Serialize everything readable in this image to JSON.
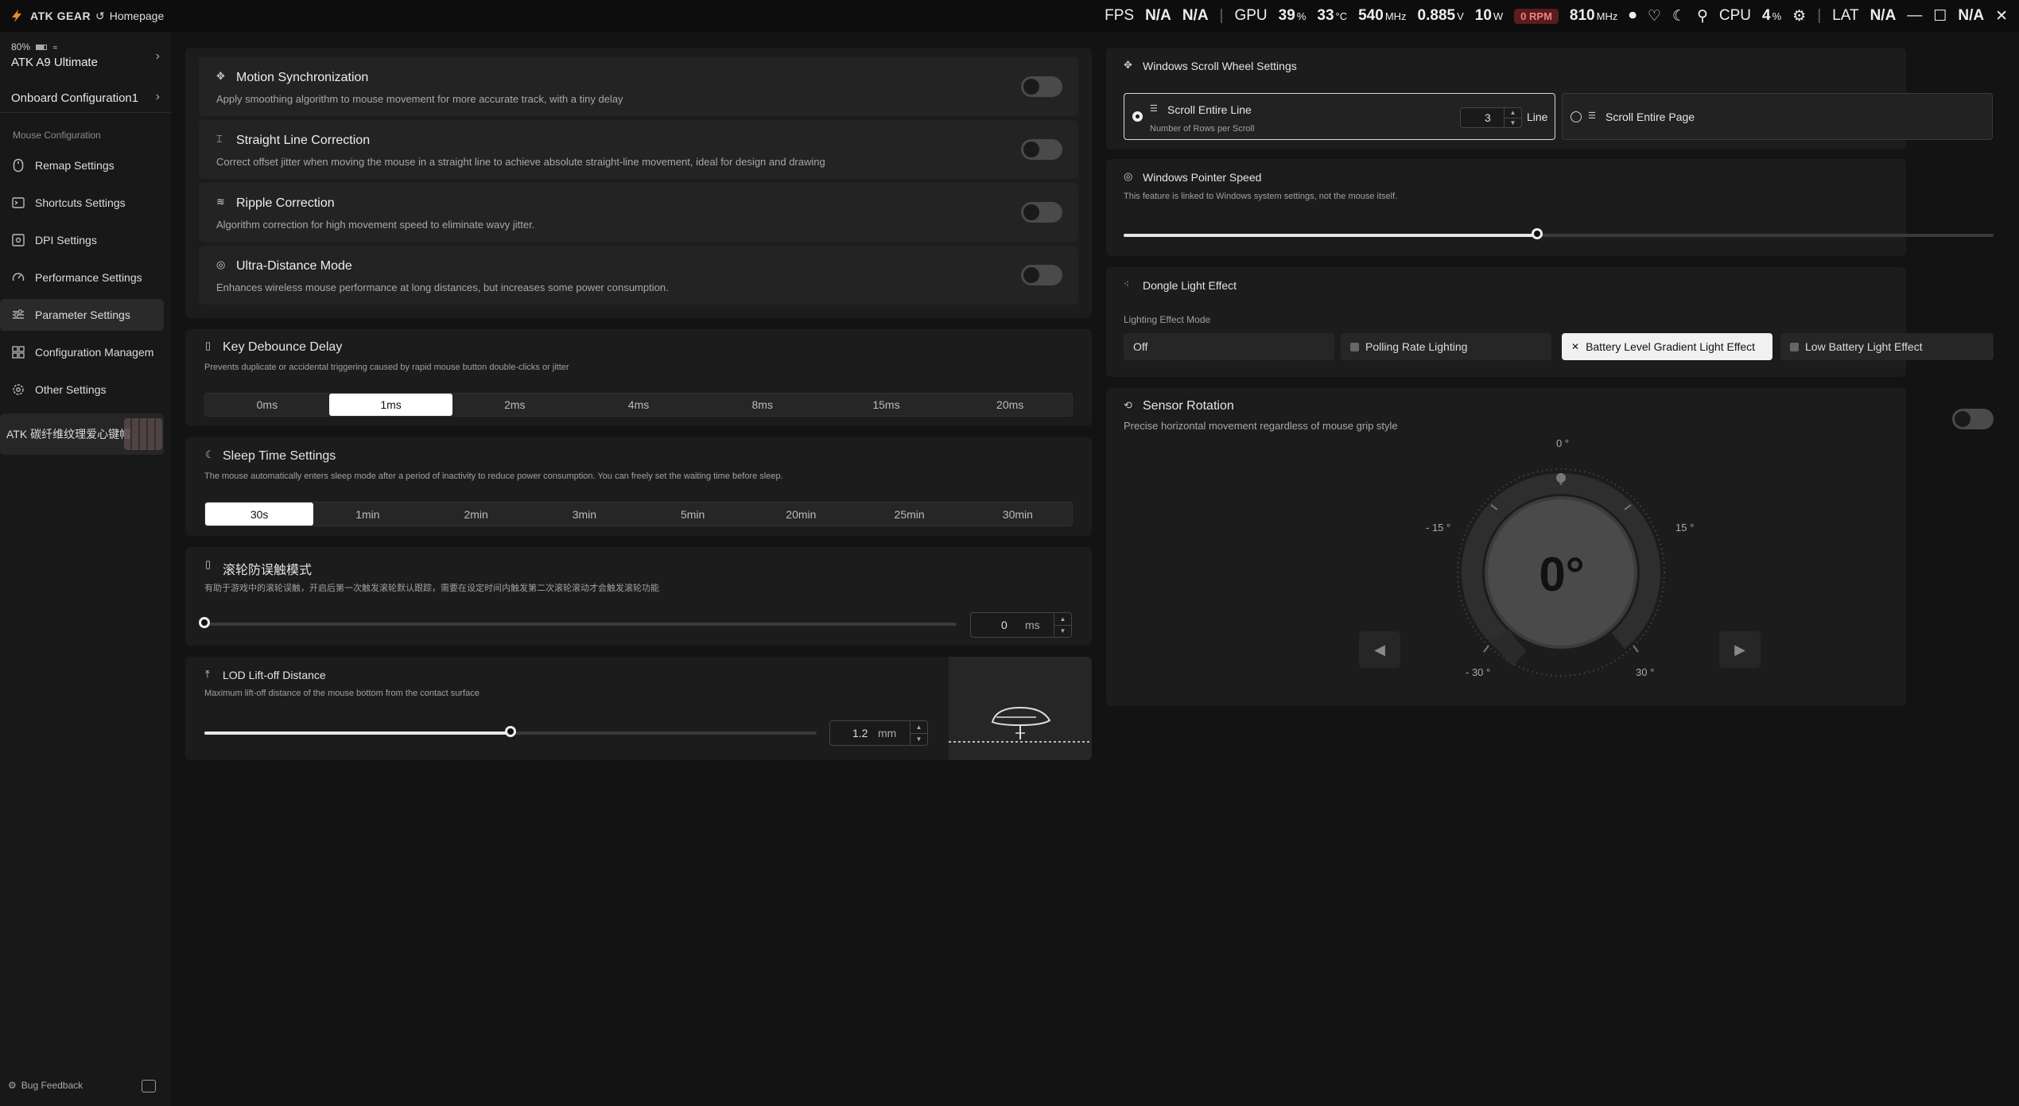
{
  "app": {
    "brand": "ATK GEAR",
    "home_label": "Homepage"
  },
  "stats": {
    "fps_label": "FPS",
    "fps": "N/A",
    "fps2": "N/A",
    "gpu_label": "GPU",
    "gpu_load": "39",
    "gpu_load_unit": "%",
    "gpu_temp": "33",
    "gpu_temp_unit": "°C",
    "gpu_clock": "540",
    "gpu_clock_unit": "MHz",
    "gpu_volt": "0.885",
    "gpu_volt_unit": "V",
    "gpu_power": "10",
    "gpu_power_unit": "W",
    "fan": "0",
    "fan_unit": "RPM",
    "mem_clock": "810",
    "mem_clock_unit": "MHz",
    "cpu_label": "CPU",
    "cpu_load": "4",
    "cpu_load_unit": "%",
    "lat_label": "LAT",
    "lat": "N/A",
    "lat2": "N/A"
  },
  "sidebar": {
    "device_battery": "80%",
    "device_name": "ATK A9 Ultimate",
    "onboard": "Onboard Configuration1",
    "section_label": "Mouse Configuration",
    "items": [
      {
        "label": "Remap Settings",
        "icon": "mouse-icon"
      },
      {
        "label": "Shortcuts Settings",
        "icon": "terminal-icon"
      },
      {
        "label": "DPI Settings",
        "icon": "dpi-icon"
      },
      {
        "label": "Performance Settings",
        "icon": "gauge-icon"
      },
      {
        "label": "Parameter Settings",
        "icon": "sliders-icon"
      },
      {
        "label": "Configuration Managem",
        "icon": "grid-icon"
      },
      {
        "label": "Other Settings",
        "icon": "gear-icon"
      }
    ],
    "active_index": 4,
    "promo": "ATK 碳纤维纹理爱心键帽",
    "bug_feedback": "Bug Feedback"
  },
  "features": [
    {
      "title": "Motion Synchronization",
      "desc": "Apply smoothing algorithm to mouse movement for more accurate track, with a tiny delay",
      "enabled": false
    },
    {
      "title": "Straight Line Correction",
      "desc": "Correct offset jitter when moving the mouse in a straight line to achieve absolute straight-line movement, ideal for design and drawing",
      "enabled": false
    },
    {
      "title": "Ripple Correction",
      "desc": "Algorithm correction for high movement speed to eliminate wavy jitter.",
      "enabled": false
    },
    {
      "title": "Ultra-Distance Mode",
      "desc": "Enhances wireless mouse performance at long distances, but increases some power consumption.",
      "enabled": false
    }
  ],
  "debounce": {
    "title": "Key Debounce Delay",
    "desc": "Prevents duplicate or accidental triggering caused by rapid mouse button double-clicks or jitter",
    "options": [
      "0ms",
      "1ms",
      "2ms",
      "4ms",
      "8ms",
      "15ms",
      "20ms"
    ],
    "selected": 1
  },
  "sleep": {
    "title": "Sleep Time Settings",
    "desc": "The mouse automatically enters sleep mode after a period of inactivity to reduce power consumption. You can freely set the waiting time before sleep.",
    "options": [
      "30s",
      "1min",
      "2min",
      "3min",
      "5min",
      "20min",
      "25min",
      "30min"
    ],
    "selected": 0
  },
  "wheel_anti": {
    "title": "滚轮防误触模式",
    "desc": "有助于游戏中的滚轮误触，开启后第一次触发滚轮默认跟踪，需要在设定时间内触发第二次滚轮滚动才会触发滚轮功能",
    "value": "0",
    "unit": "ms",
    "fraction": 0
  },
  "lod": {
    "title": "LOD Lift-off Distance",
    "desc": "Maximum lift-off distance of the mouse bottom from the contact surface",
    "value": "1.2",
    "unit": "mm",
    "fraction": 0.5
  },
  "scroll": {
    "title": "Windows Scroll Wheel Settings",
    "line_label": "Scroll Entire Line",
    "line_sub": "Number of Rows per Scroll",
    "line_value": "3",
    "line_unit": "Line",
    "page_label": "Scroll Entire Page",
    "selected": "line"
  },
  "pointer": {
    "title": "Windows Pointer Speed",
    "desc": "This feature is linked to Windows system settings, not the mouse itself.",
    "fraction": 0.475
  },
  "dongle": {
    "title": "Dongle Light Effect",
    "mode_label": "Lighting Effect Mode",
    "options": [
      "Off",
      "Polling Rate Lighting",
      "Battery Level Gradient Light Effect",
      "Low Battery Light Effect"
    ],
    "selected": 2
  },
  "rotation": {
    "title": "Sensor Rotation",
    "desc": "Precise horizontal movement regardless of mouse grip style",
    "enabled": false,
    "value": "0°",
    "tick_top": "0 °",
    "tick_left": "- 15 °",
    "tick_right": "15 °",
    "tick_bl": "- 30 °",
    "tick_br": "30 °"
  }
}
